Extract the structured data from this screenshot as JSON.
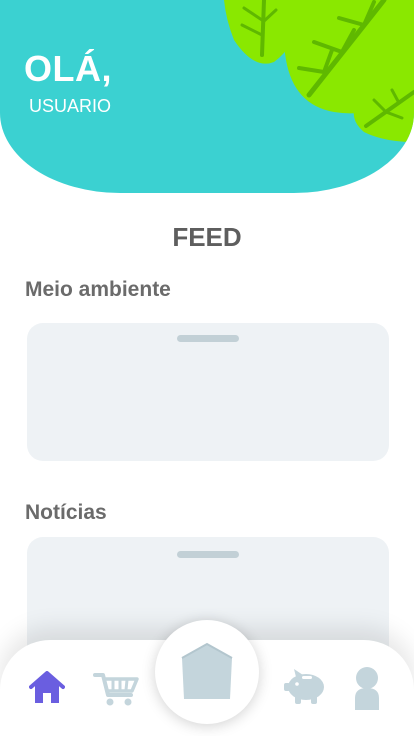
{
  "header": {
    "greeting": "OLÁ,",
    "username": "USUARIO"
  },
  "feed": {
    "title": "FEED",
    "sections": [
      {
        "title": "Meio ambiente"
      },
      {
        "title": "Notícias"
      }
    ]
  },
  "colors": {
    "header_bg": "#3bd1d1",
    "leaf_green": "#8ae800",
    "leaf_dark": "#5fb800",
    "card_bg": "#eef2f5",
    "nav_active": "#6a5ee0",
    "nav_inactive": "#c4d5dc"
  },
  "nav": {
    "items": [
      {
        "name": "home-icon",
        "active": true
      },
      {
        "name": "shopping-cart-icon",
        "active": false
      },
      {
        "name": "home-center-icon",
        "active": false
      },
      {
        "name": "piggy-bank-icon",
        "active": false
      },
      {
        "name": "profile-icon",
        "active": false
      }
    ]
  }
}
